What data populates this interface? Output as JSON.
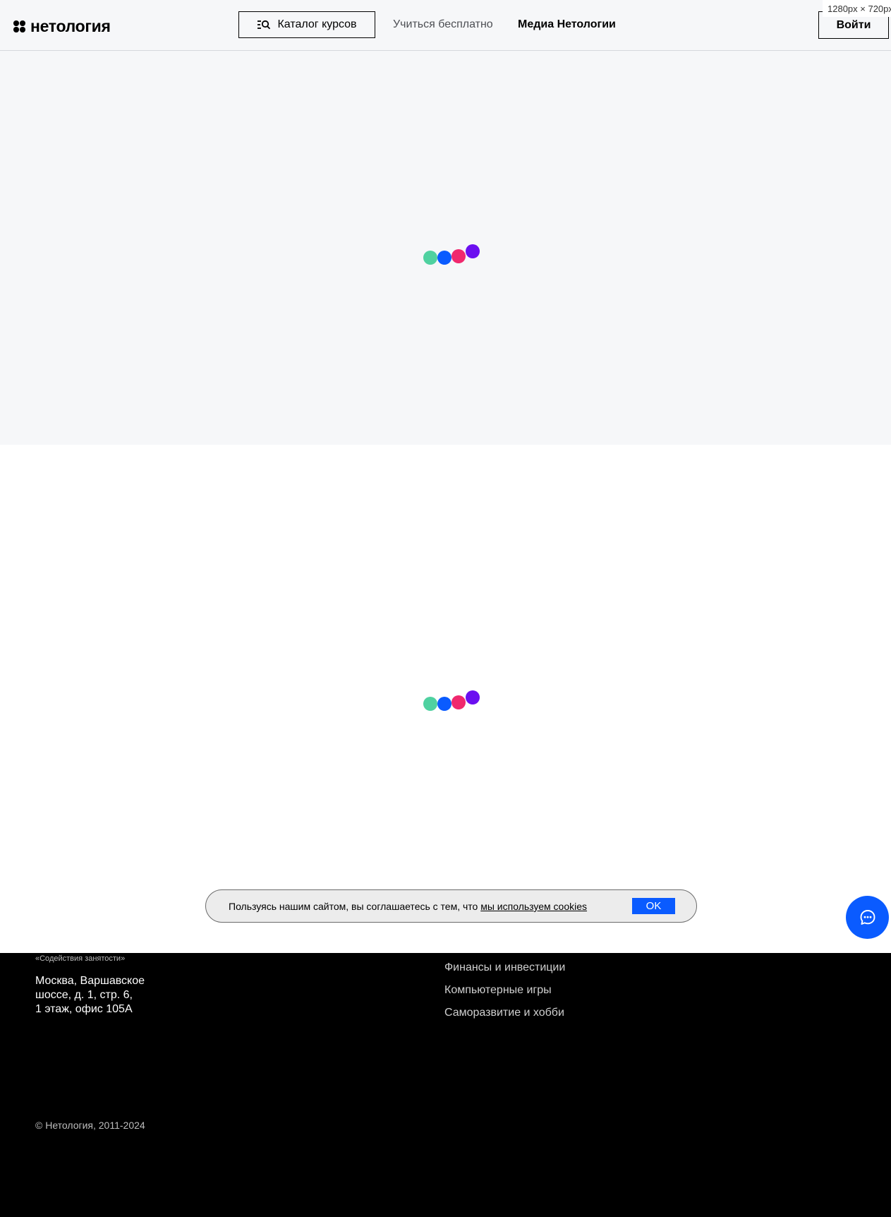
{
  "viewport_label": "1280px × 720px",
  "header": {
    "logo_text": "нетология",
    "catalog_label": "Каталог курсов",
    "nav": {
      "learn_free": "Учиться бесплатно",
      "media": "Медиа Нетологии"
    },
    "login_label": "Войти"
  },
  "loader_colors": [
    "#4fd1a0",
    "#0a5bff",
    "#f0286e",
    "#6b0ff0"
  ],
  "footer": {
    "employment_note": "«Содействия занятости»",
    "address_lines": [
      "Москва, Варшавское",
      "шоссе, д. 1, стр. 6,",
      "1 этаж, офис 105А"
    ],
    "categories": [
      "Финансы и инвестиции",
      "Компьютерные игры",
      "Саморазвитие и хобби"
    ],
    "copyright": "© Нетология, 2011-2024"
  },
  "cookie_banner": {
    "text": "Пользуясь нашим сайтом, вы соглашаетесь с тем, что",
    "link_text": "мы используем cookies",
    "ok_label": "OK"
  },
  "colors": {
    "accent": "#0a5bff",
    "page_bg": "#f6f7f9",
    "footer_bg": "#000000"
  },
  "icons": {
    "catalog": "catalog-search-icon",
    "chat": "chat-icon"
  }
}
